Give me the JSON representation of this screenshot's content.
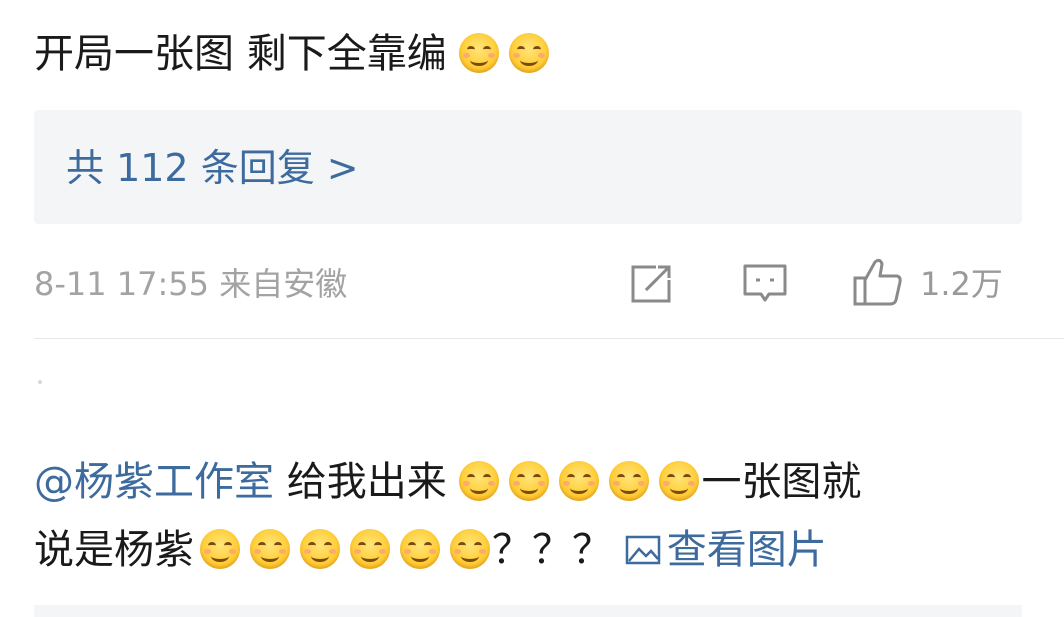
{
  "post": {
    "text": "开局一张图 剩下全靠编",
    "emojis": [
      "smile",
      "smile"
    ],
    "reply_link": "共 112 条回复 >",
    "meta": "8-11 17:55  来自安徽",
    "like_count": "1.2万",
    "icons": [
      "share-icon",
      "comment-icon",
      "thumbs-up-icon"
    ]
  },
  "reply": {
    "mention": "@杨紫工作室",
    "text_a": " 给我出来 ",
    "text_b": "一张图就",
    "text_c": "说是杨紫",
    "text_d": "？？？ ",
    "view_image": "查看图片",
    "emojis_line1": 5,
    "emojis_line2": 6
  },
  "colors": {
    "link": "#3d6b9e",
    "meta": "#a3a3a3",
    "box": "#f4f5f7"
  }
}
